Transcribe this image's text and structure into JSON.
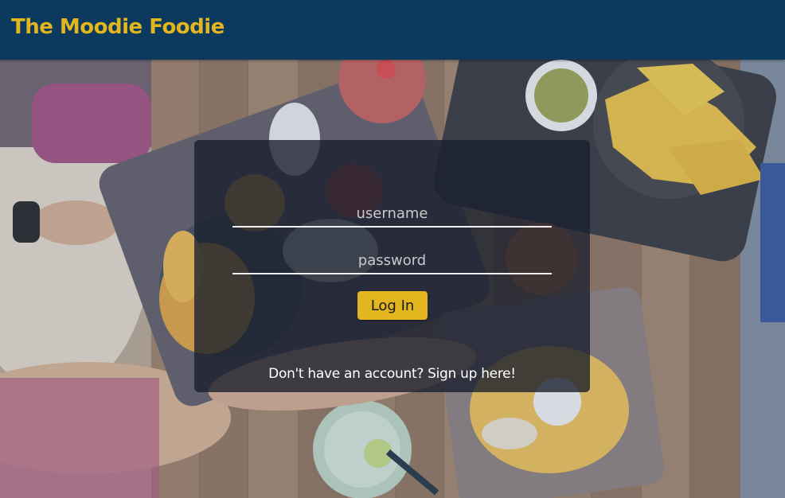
{
  "header": {
    "brand": "The Moodie Foodie"
  },
  "login": {
    "username_placeholder": "username",
    "password_placeholder": "password",
    "login_label": "Log In",
    "signup_text": "Don't have an account? Sign up here!"
  },
  "colors": {
    "navbar": "#0b3a5e",
    "brand": "#e3b51e",
    "button": "#e3b51e"
  },
  "background": {
    "image": "food-table-photo"
  }
}
